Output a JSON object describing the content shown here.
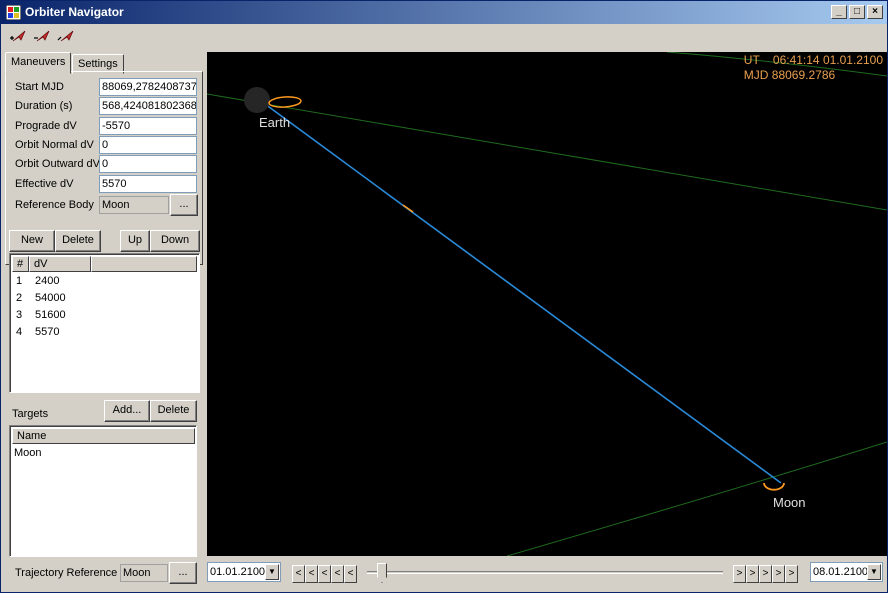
{
  "window": {
    "title": "Orbiter Navigator",
    "minimize": "_",
    "maximize": "□",
    "close": "×"
  },
  "toolbar": {
    "icons": [
      "arrow-add-icon",
      "arrow-remove-icon",
      "arrow-edit-icon"
    ]
  },
  "tabs": {
    "maneuvers": "Maneuvers",
    "settings": "Settings"
  },
  "maneuver": {
    "start_mjd_label": "Start MJD",
    "start_mjd": "88069,2782408737",
    "duration_label": "Duration (s)",
    "duration": "568,424081802368",
    "prograde_label": "Prograde dV",
    "prograde": "-5570",
    "normal_label": "Orbit Normal dV",
    "normal": "0",
    "outward_label": "Orbit Outward dV",
    "outward": "0",
    "effective_label": "Effective dV",
    "effective": "5570",
    "refbody_label": "Reference Body",
    "refbody": "Moon",
    "browse": "..."
  },
  "list_buttons": {
    "new": "New",
    "delete": "Delete",
    "up": "Up",
    "down": "Down"
  },
  "maneuver_list": {
    "col_num": "#",
    "col_dv": "dV",
    "rows": [
      {
        "num": "1",
        "dv": "2400"
      },
      {
        "num": "2",
        "dv": "54000"
      },
      {
        "num": "3",
        "dv": "51600"
      },
      {
        "num": "4",
        "dv": "5570"
      }
    ]
  },
  "targets": {
    "label": "Targets",
    "add": "Add...",
    "delete": "Delete",
    "col_name": "Name",
    "items": [
      "Moon"
    ]
  },
  "trajectory": {
    "label": "Trajectory Reference",
    "value": "Moon",
    "browse": "..."
  },
  "viewport": {
    "ut": "UT    06:41:14 01.01.2100",
    "mjd": "MJD 88069.2786",
    "earth": "Earth",
    "moon": "Moon"
  },
  "timeline": {
    "start_date": "01.01.2100",
    "end_date": "08.01.2100",
    "back": "<",
    "forward": ">"
  },
  "colors": {
    "trajectory": "#2a8ad8",
    "orbit": "#1f6b1f",
    "marker": "#ff9a20"
  }
}
